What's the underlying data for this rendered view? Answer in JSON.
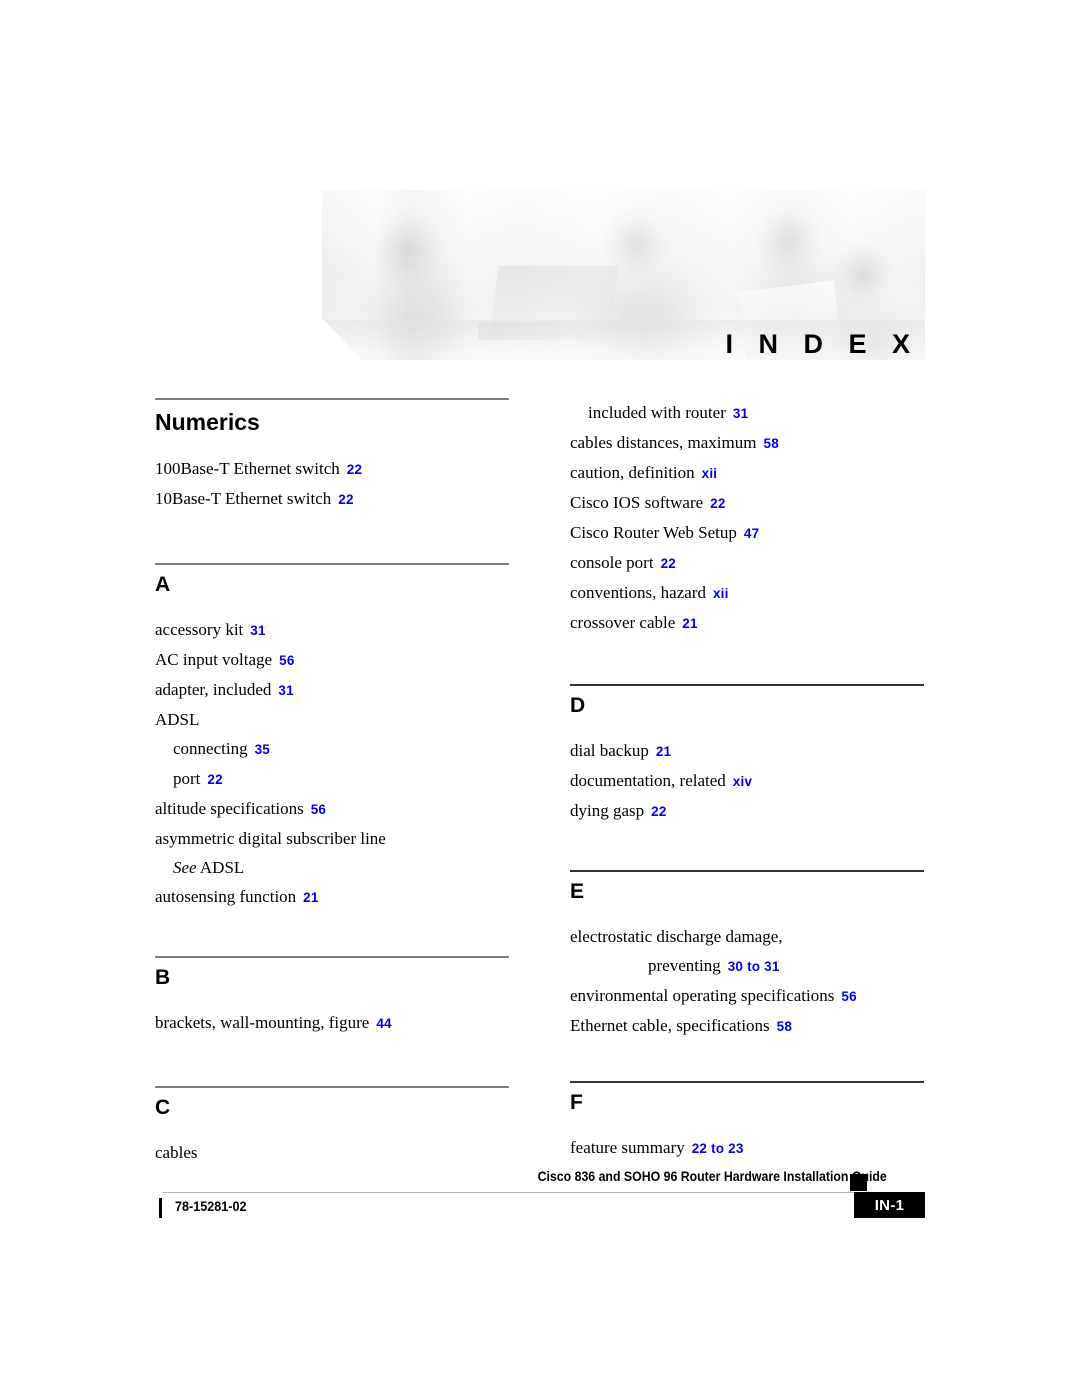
{
  "header": {
    "banner_label": "I N D E X"
  },
  "columns": {
    "left": {
      "sections": [
        {
          "title": "Numerics",
          "entries": [
            {
              "text": "100Base-T Ethernet switch",
              "page": "22",
              "level": 1
            },
            {
              "text": "10Base-T Ethernet switch",
              "page": "22",
              "level": 1
            }
          ]
        },
        {
          "title": "A",
          "entries": [
            {
              "text": "accessory kit",
              "page": "31",
              "level": 1
            },
            {
              "text": "AC input voltage",
              "page": "56",
              "level": 1
            },
            {
              "text": "adapter, included",
              "page": "31",
              "level": 1
            },
            {
              "text": "ADSL",
              "page": "",
              "level": 1
            },
            {
              "text": "connecting",
              "page": "35",
              "level": 2
            },
            {
              "text": "port",
              "page": "22",
              "level": 2
            },
            {
              "text": "altitude specifications",
              "page": "56",
              "level": 1
            },
            {
              "text": "asymmetric digital subscriber line",
              "page": "",
              "level": 1
            },
            {
              "text": "See ADSL",
              "page": "",
              "level": 2,
              "italic_prefix": "See",
              "rest": " ADSL"
            },
            {
              "text": "autosensing function",
              "page": "21",
              "level": 1
            }
          ]
        },
        {
          "title": "B",
          "entries": [
            {
              "text": "brackets, wall-mounting, figure",
              "page": "44",
              "level": 1
            }
          ]
        },
        {
          "title": "C",
          "entries": [
            {
              "text": "cables",
              "page": "",
              "level": 1
            }
          ]
        }
      ]
    },
    "right": {
      "sections": [
        {
          "title": "",
          "entries": [
            {
              "text": "included with router",
              "page": "31",
              "level": 2
            },
            {
              "text": "cables distances, maximum",
              "page": "58",
              "level": 1
            },
            {
              "text": "caution, definition",
              "page": "xii",
              "level": 1
            },
            {
              "text": "Cisco IOS software",
              "page": "22",
              "level": 1
            },
            {
              "text": "Cisco Router Web Setup",
              "page": "47",
              "level": 1
            },
            {
              "text": "console port",
              "page": "22",
              "level": 1
            },
            {
              "text": "conventions, hazard",
              "page": "xii",
              "level": 1
            },
            {
              "text": "crossover cable",
              "page": "21",
              "level": 1
            }
          ]
        },
        {
          "title": "D",
          "entries": [
            {
              "text": "dial backup",
              "page": "21",
              "level": 1
            },
            {
              "text": "documentation, related",
              "page": "xiv",
              "level": 1
            },
            {
              "text": "dying gasp",
              "page": "22",
              "level": 1
            }
          ]
        },
        {
          "title": "E",
          "entries": [
            {
              "text": "electrostatic discharge damage,",
              "page": "",
              "level": 1
            },
            {
              "text": "preventing",
              "page": "30 to 31",
              "level": "wrap"
            },
            {
              "text": "environmental operating specifications",
              "page": "56",
              "level": 1
            },
            {
              "text": "Ethernet cable, specifications",
              "page": "58",
              "level": 1
            }
          ]
        },
        {
          "title": "F",
          "entries": [
            {
              "text": "feature summary",
              "page": "22 to 23",
              "level": 1
            }
          ]
        }
      ]
    }
  },
  "footer": {
    "title": "Cisco 836 and SOHO 96 Router Hardware Installation Guide",
    "doc_number": "78-15281-02",
    "page_label": "IN-1"
  },
  "colors": {
    "page_number_blue": "#0000ee",
    "rule_gray": "#7d7d7d",
    "footer_rule": "#b4b4b4"
  }
}
